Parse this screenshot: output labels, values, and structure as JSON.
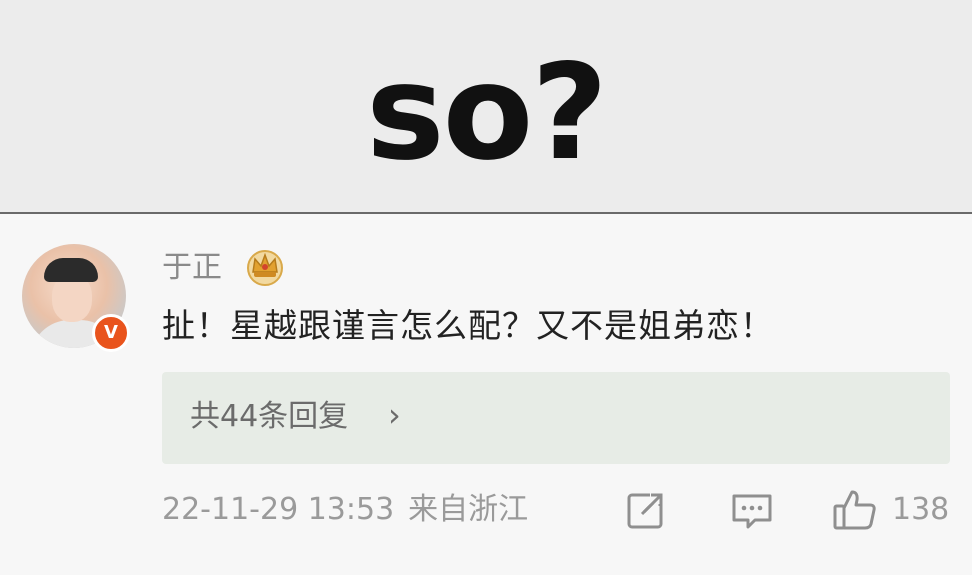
{
  "meme": {
    "caption": "so?"
  },
  "comment": {
    "username": "于正",
    "verified_badge": "V",
    "text": "扯！星越跟谨言怎么配？又不是姐弟恋！",
    "replies_label": "共44条回复",
    "replies_chevron": "›",
    "timestamp": "22-11-29 13:53",
    "location": "来自浙江",
    "like_count": "138",
    "icons": {
      "badge": "crown-badge-icon",
      "share": "share-icon",
      "comment": "comment-icon",
      "like": "thumbs-up-icon"
    },
    "colors": {
      "verified": "#e9541d",
      "reply_box": "#e7ece6",
      "meta_text": "#9a9a9a"
    }
  }
}
